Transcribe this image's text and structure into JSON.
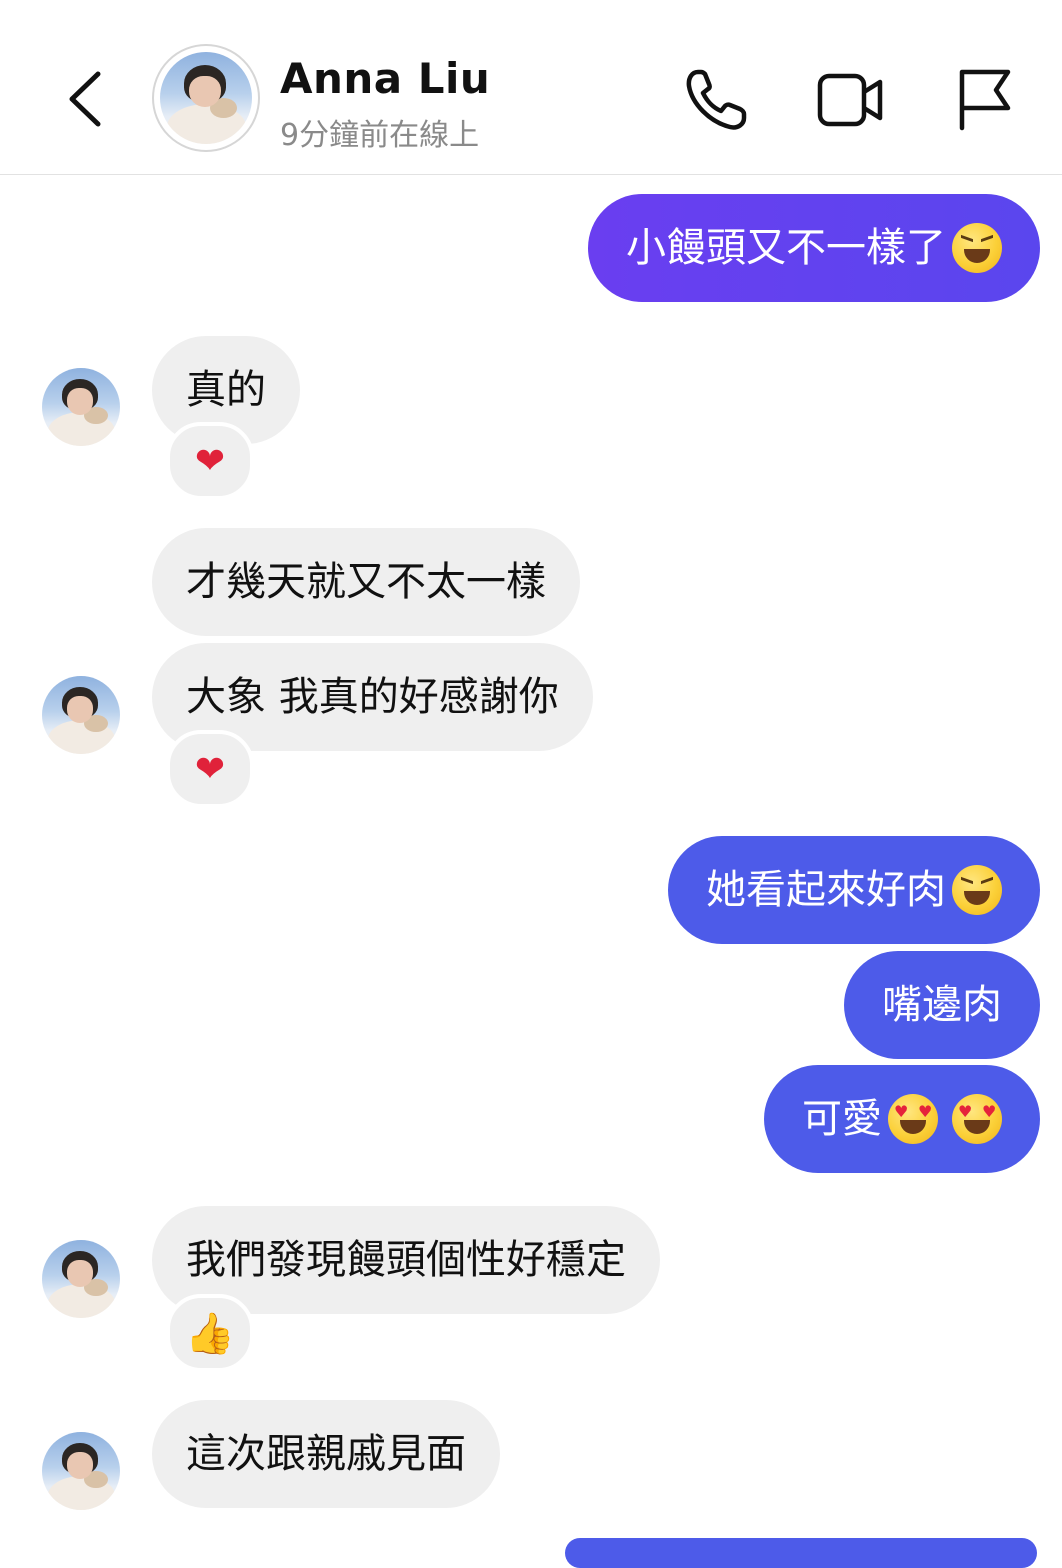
{
  "header": {
    "name": "Anna Liu",
    "status": "9分鐘前在線上",
    "icons": {
      "back": "chevron-left-icon",
      "call": "phone-icon",
      "video": "video-icon",
      "report": "flag-icon"
    }
  },
  "messages": [
    {
      "dir": "out",
      "text": "小饅頭又不一樣了",
      "emoji": "grinning-squinting-face"
    },
    {
      "dir": "in",
      "text": "真的",
      "reaction": "❤"
    },
    {
      "dir": "in",
      "text": "才幾天就又不太一樣"
    },
    {
      "dir": "in",
      "text": "大象 我真的好感謝你",
      "reaction": "❤"
    },
    {
      "dir": "out",
      "text": "她看起來好肉",
      "emoji": "grinning-squinting-face"
    },
    {
      "dir": "out",
      "text": "嘴邊肉"
    },
    {
      "dir": "out",
      "text": "可愛",
      "emoji": "heart-eyes-face x2"
    },
    {
      "dir": "in",
      "text": "我們發現饅頭個性好穩定",
      "reaction": "👍"
    },
    {
      "dir": "in",
      "text": "這次跟親戚見面"
    }
  ],
  "colors": {
    "outgoing": "#5a46ee",
    "incoming": "#efefef",
    "status": "#8a8a8a"
  }
}
